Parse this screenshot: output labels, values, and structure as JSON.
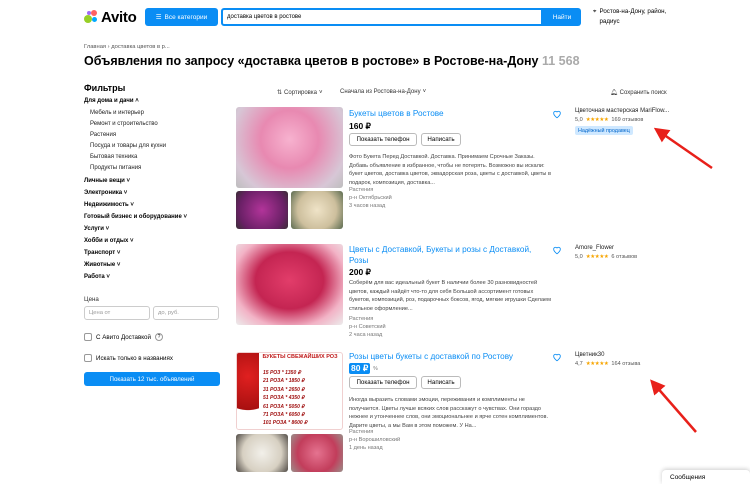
{
  "header": {
    "logo": "Avito",
    "categories_btn": "Все категории",
    "search_value": "доставка цветов в ростове",
    "find_btn": "Найти",
    "location": "Ростов-на-Дону, район, радиус"
  },
  "breadcrumb": "Главная › доставка цветов в р...",
  "title": "Объявления по запросу «доставка цветов в ростове» в Ростове-на-Дону",
  "title_count": "11 568",
  "filters": {
    "heading": "Фильтры",
    "home_garden": "Для дома и дачи",
    "sub": [
      "Мебель и интерьер",
      "Ремонт и строительство",
      "Растения",
      "Посуда и товары для кухни",
      "Бытовая техника",
      "Продукты питания"
    ],
    "cats": [
      "Личные вещи",
      "Электроника",
      "Недвижимость",
      "Готовый бизнес и оборудование",
      "Услуги",
      "Хобби и отдых",
      "Транспорт",
      "Животные",
      "Работа"
    ],
    "price_label": "Цена",
    "price_from": "Цена от",
    "price_to": "до, руб.",
    "avito_delivery": "С Авито Доставкой",
    "only_titles": "Искать только в названиях",
    "show_btn": "Показать 12 тыс. объявлений"
  },
  "toolbar": {
    "sort": "Сортировка",
    "near": "Сначала из Ростова-на-Дону",
    "save": "Сохранить поиск"
  },
  "listings": [
    {
      "title": "Букеты цветов в Ростове",
      "price": "160 ₽",
      "btn_phone": "Показать телефон",
      "btn_write": "Написать",
      "desc": "Фото Букета Перед Доставкой. Доставка. Принимаем Срочные Заказы. Добавь объявление в избранное, чтобы не потерять. Возможно вы искали: букет цветов, доставка цветов, эквадорская роза, цветы с доставкой, цветы в подарок, композиция, доставка...",
      "category": "Растения",
      "district": "р-н Октябрьский",
      "time": "3 часов назад",
      "seller": "Цветочная мастерская МariFlow...",
      "rating": "5,0",
      "stars": "★★★★★",
      "reviews": "169 отзывов",
      "badge": "Надёжный продавец"
    },
    {
      "title": "Цветы с Доставкой, Букеты и розы с Доставкой, Розы",
      "price": "200 ₽",
      "desc": "Соберём для вас идеальный букет В наличии более 30 разновидностей цветов, каждый найдёт что-то для себя Большой ассортимент готовых букетов, композиций, роз, подарочных боксов, ягод, мягкие игрушки Сделаем стильное оформление...",
      "category": "Растения",
      "district": "р-н Советский",
      "time": "2 часа назад",
      "seller": "Amore_Flower",
      "rating": "5,0",
      "stars": "★★★★★",
      "reviews": "6 отзывов"
    },
    {
      "title": "Розы цветы букеты с доставкой по Ростову",
      "price": "80 ₽",
      "price_badge": "%",
      "btn_phone": "Показать телефон",
      "btn_write": "Написать",
      "desc": "Иногда выразить словами эмоции, переживания и комплименты не получается. Цветы лучше всяких слов расскажут о чувствах. Они гораздо нежнее и утонченнее слов, они эмоциональнее и ярче сотен комплиментов. Дарите цветы, а мы Вам в этом поможем. У На...",
      "category": "Растения",
      "district": "р-н Ворошиловский",
      "time": "1 день назад",
      "seller": "Цветник30",
      "rating": "4,7",
      "stars": "★★★★★",
      "reviews": "164 отзыва",
      "poster_title": "БУКЕТЫ СВЕЖАЙШИХ РОЗ",
      "poster_lines": [
        "15 РОЗ * 1350 ₽",
        "21 РОЗА * 1850 ₽",
        "31 РОЗА * 2650 ₽",
        "51 РОЗА * 4350 ₽",
        "61 РОЗА * 5050 ₽",
        "71 РОЗА * 6050 ₽",
        "101 РОЗА * 8600 ₽"
      ]
    }
  ],
  "messages": "Сообщения",
  "colors": {
    "accent": "#0a8df4",
    "annotation": "#e8201a"
  }
}
